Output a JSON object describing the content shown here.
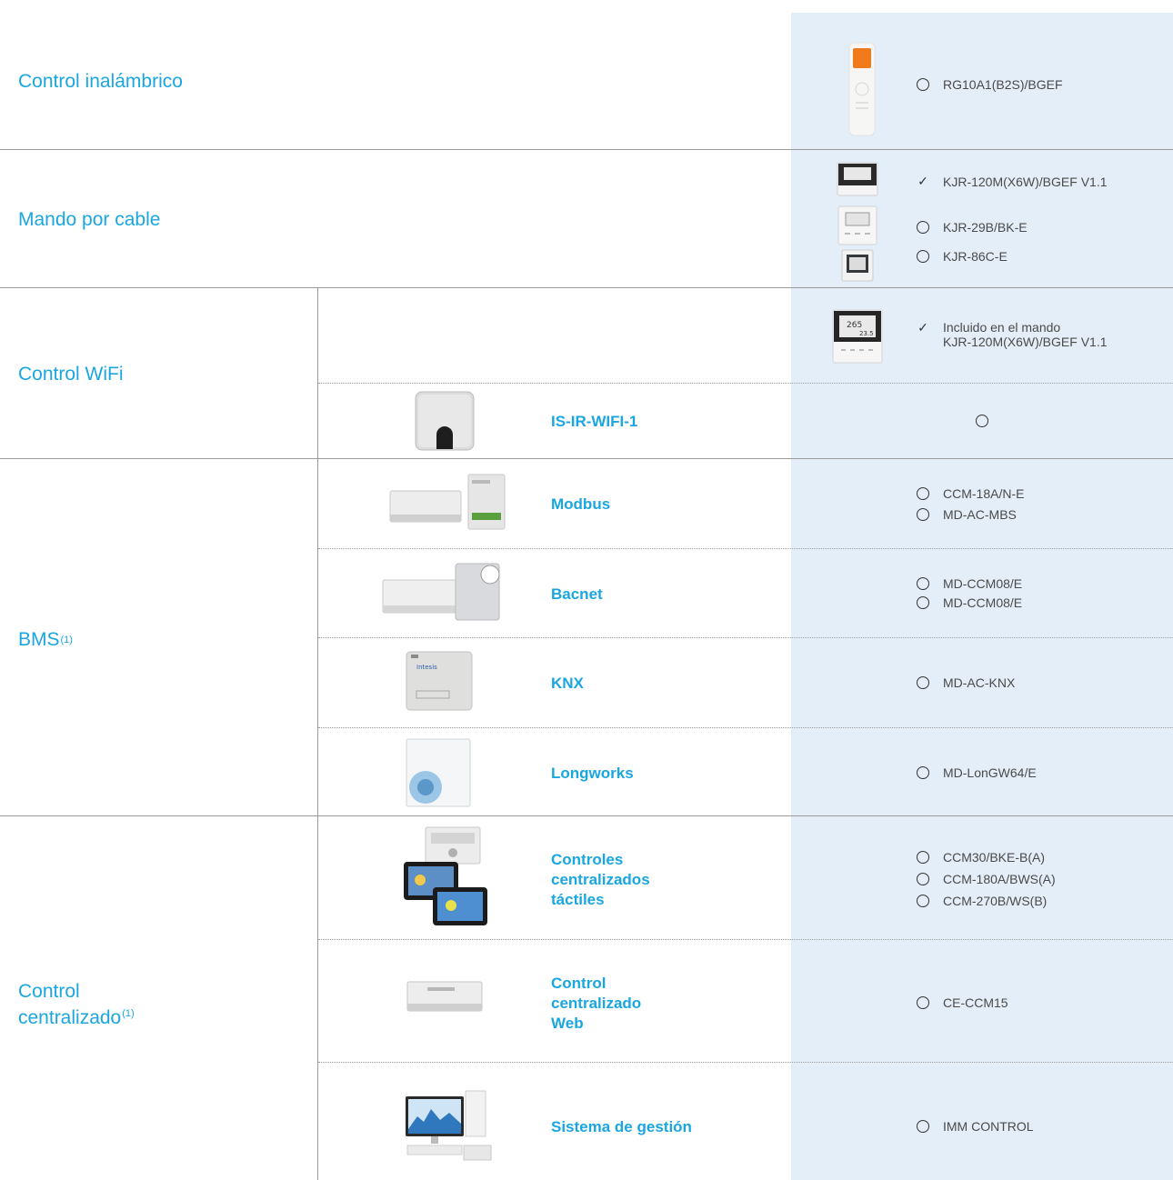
{
  "rows": {
    "inalambrico": {
      "label": "Control inalámbrico",
      "options": [
        {
          "mark": "circle",
          "text": "RG10A1(B2S)/BGEF"
        }
      ]
    },
    "cable": {
      "label": "Mando por cable",
      "options": [
        {
          "mark": "check",
          "text": "KJR-120M(X6W)/BGEF V1.1"
        },
        {
          "mark": "circle",
          "text": "KJR-29B/BK-E"
        },
        {
          "mark": "circle",
          "text": "KJR-86C-E"
        }
      ]
    },
    "wifi": {
      "label": "Control WiFi",
      "included": {
        "mark": "check",
        "line1": "Incluido en el mando",
        "line2": "KJR-120M(X6W)/BGEF V1.1"
      },
      "sub": {
        "name": "IS-IR-WIFI-1",
        "mark": "circle"
      }
    },
    "bms": {
      "label": "BMS",
      "sup": "(1)",
      "subs": [
        {
          "name": "Modbus",
          "options": [
            "CCM-18A/N-E",
            "MD-AC-MBS"
          ]
        },
        {
          "name": "Bacnet",
          "options": [
            "MD-CCM08/E",
            "MD-CCM08/E"
          ]
        },
        {
          "name": "KNX",
          "options": [
            "MD-AC-KNX"
          ]
        },
        {
          "name": "Longworks",
          "options": [
            "MD-LonGW64/E"
          ]
        }
      ]
    },
    "centralizado": {
      "label_line1": "Control",
      "label_line2": "centralizado",
      "sup": "(1)",
      "subs": [
        {
          "name_lines": [
            "Controles",
            "centralizados",
            "táctiles"
          ],
          "options": [
            "CCM30/BKE-B(A)",
            "CCM-180A/BWS(A)",
            "CCM-270B/WS(B)"
          ]
        },
        {
          "name_lines": [
            "Control",
            "centralizado",
            "Web"
          ],
          "options": [
            "CE-CCM15"
          ]
        },
        {
          "name_lines": [
            "Sistema de gestión"
          ],
          "options": [
            "IMM CONTROL"
          ]
        }
      ]
    }
  },
  "colors": {
    "accent": "#1aa6e0",
    "highlight_column": "#e3eef8",
    "line": "#9a9a9a"
  }
}
